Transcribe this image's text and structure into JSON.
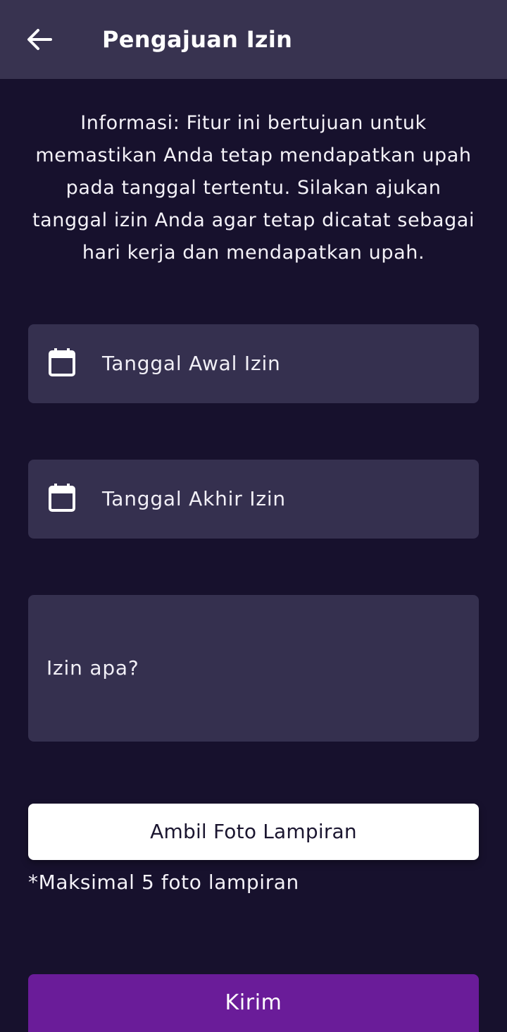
{
  "appbar": {
    "back_icon": "arrow-left-icon",
    "title": "Pengajuan Izin"
  },
  "info": {
    "text": "Informasi: Fitur ini bertujuan untuk memastikan Anda tetap mendapatkan upah pada tanggal tertentu. Silakan ajukan tanggal izin Anda agar tetap dicatat sebagai hari kerja dan mendapatkan upah."
  },
  "form": {
    "start_date": {
      "icon": "calendar-icon",
      "placeholder": "Tanggal Awal Izin"
    },
    "end_date": {
      "icon": "calendar-icon",
      "placeholder": "Tanggal Akhir Izin"
    },
    "reason": {
      "placeholder": "Izin apa?"
    },
    "photo_button_label": "Ambil Foto Lampiran",
    "photo_note": "*Maksimal 5 foto lampiran",
    "submit_label": "Kirim"
  },
  "colors": {
    "background": "#17112d",
    "appbar": "#383350",
    "field": "#35304f",
    "submit": "#6a1c99"
  }
}
